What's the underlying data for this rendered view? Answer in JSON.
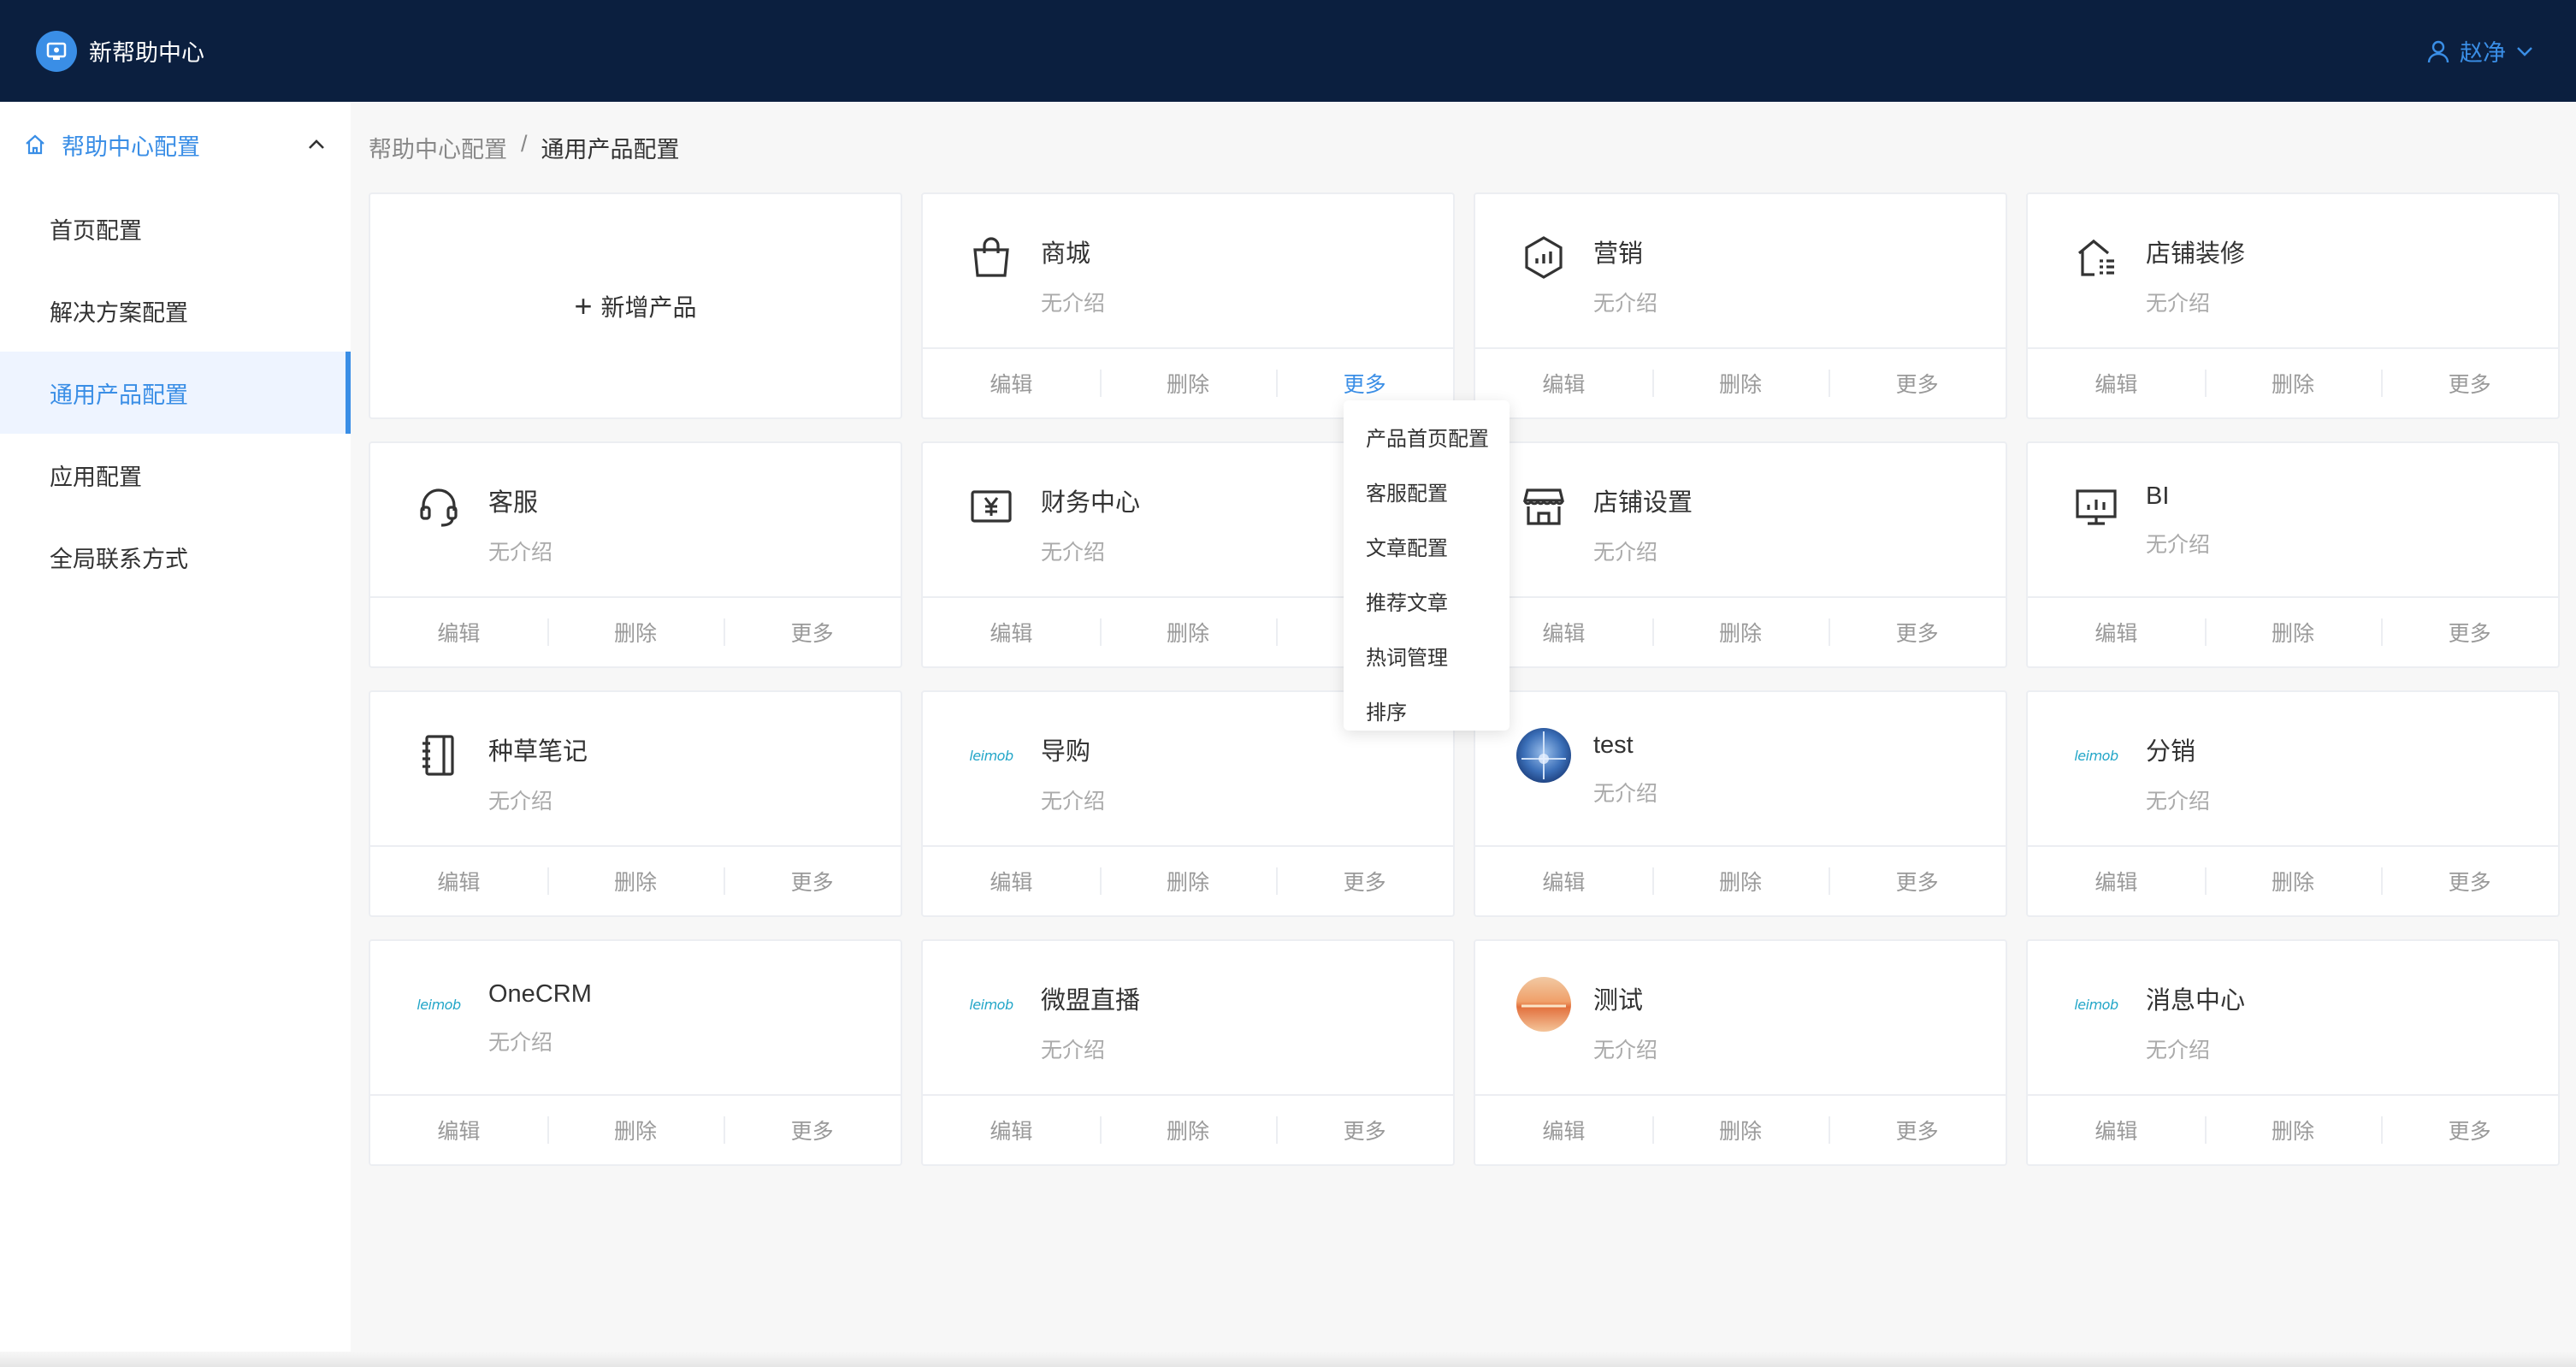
{
  "header": {
    "title": "新帮助中心",
    "user_name": "赵净"
  },
  "sidebar": {
    "group_label": "帮助中心配置",
    "items": [
      {
        "label": "首页配置"
      },
      {
        "label": "解决方案配置"
      },
      {
        "label": "通用产品配置",
        "active": true
      },
      {
        "label": "应用配置"
      },
      {
        "label": "全局联系方式"
      }
    ]
  },
  "breadcrumb": {
    "parent": "帮助中心配置",
    "separator": "/",
    "current": "通用产品配置"
  },
  "add_card": {
    "label": "新增产品"
  },
  "actions": {
    "edit": "编辑",
    "delete": "删除",
    "more": "更多"
  },
  "logo_text": "leimob",
  "cards": [
    {
      "title": "商城",
      "desc": "无介绍",
      "icon": "shopping-bag-icon"
    },
    {
      "title": "营销",
      "desc": "无介绍",
      "icon": "hexagon-chart-icon"
    },
    {
      "title": "店铺装修",
      "desc": "无介绍",
      "icon": "house-list-icon"
    },
    {
      "title": "客服",
      "desc": "无介绍",
      "icon": "headset-icon"
    },
    {
      "title": "财务中心",
      "desc": "无介绍",
      "icon": "yen-icon"
    },
    {
      "title": "店铺设置",
      "desc": "无介绍",
      "icon": "store-icon"
    },
    {
      "title": "BI",
      "desc": "无介绍",
      "icon": "monitor-chart-icon"
    },
    {
      "title": "种草笔记",
      "desc": "无介绍",
      "icon": "notebook-icon"
    },
    {
      "title": "导购",
      "desc": "无介绍",
      "icon": "leimob-logo"
    },
    {
      "title": "test",
      "desc": "无介绍",
      "icon": "blue-photo-avatar"
    },
    {
      "title": "分销",
      "desc": "无介绍",
      "icon": "leimob-logo"
    },
    {
      "title": "OneCRM",
      "desc": "无介绍",
      "icon": "leimob-logo"
    },
    {
      "title": "微盟直播",
      "desc": "无介绍",
      "icon": "leimob-logo"
    },
    {
      "title": "测试",
      "desc": "无介绍",
      "icon": "sunset-photo-avatar"
    },
    {
      "title": "消息中心",
      "desc": "无介绍",
      "icon": "leimob-logo"
    }
  ],
  "dropdown": {
    "options": [
      "产品首页配置",
      "客服配置",
      "文章配置",
      "推荐文章",
      "热词管理",
      "排序"
    ]
  },
  "colors": {
    "header_bg": "#0b1f3f",
    "accent": "#3a8ee6",
    "leimob_logo": "#23a6c8"
  }
}
